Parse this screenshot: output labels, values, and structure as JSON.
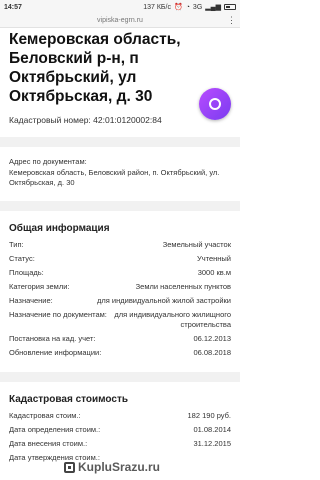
{
  "status_bar": {
    "time": "14:57",
    "network_speed": "137 КБ/с",
    "network": "3G"
  },
  "browser": {
    "url": "vipiska-egrn.ru"
  },
  "property": {
    "title": "Кемеровская область, Беловский р-н, п Октябрьский, ул Октябрьская, д. 30",
    "cadastral_label": "Кадастровый номер:",
    "cadastral_number": "42:01:0120002:84"
  },
  "doc_address": {
    "label": "Адрес по документам:",
    "value": "Кемеровская область, Беловский район, п. Октябрьский, ул. Октябрьская, д. 30"
  },
  "general": {
    "title": "Общая информация",
    "rows": [
      {
        "k": "Тип:",
        "v": "Земельный участок"
      },
      {
        "k": "Статус:",
        "v": "Учтенный"
      },
      {
        "k": "Площадь:",
        "v": "3000 кв.м"
      },
      {
        "k": "Категория земли:",
        "v": "Земли населенных пунктов"
      },
      {
        "k": "Назначение:",
        "v": "для индивидуальной жилой застройки"
      },
      {
        "k": "Назначение по документам:",
        "v": "для индивидуального жилищного строительства"
      },
      {
        "k": "Постановка на кад. учет:",
        "v": "06.12.2013"
      },
      {
        "k": "Обновление информации:",
        "v": "06.08.2018"
      }
    ]
  },
  "cost": {
    "title": "Кадастровая стоимость",
    "rows": [
      {
        "k": "Кадастровая стоим.:",
        "v": "182 190 руб."
      },
      {
        "k": "Дата определения стоим.:",
        "v": "01.08.2014"
      },
      {
        "k": "Дата внесения стоим.:",
        "v": "31.12.2015"
      },
      {
        "k": "Дата утверждения стоим.:",
        "v": ""
      }
    ]
  },
  "watermark": {
    "text": "KupluSrazu.ru"
  }
}
